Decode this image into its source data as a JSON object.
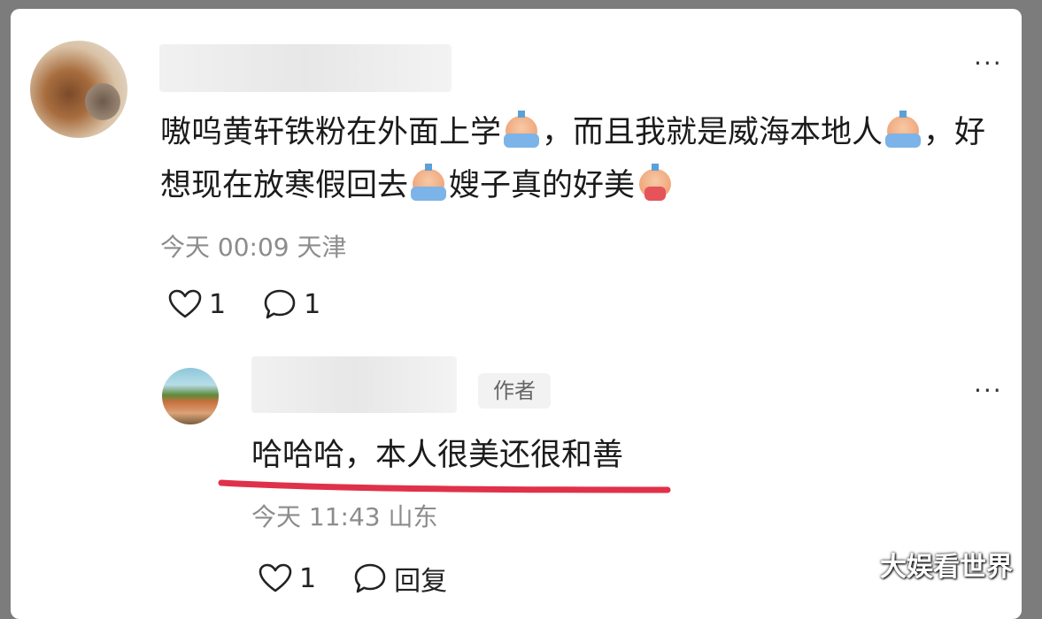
{
  "comment": {
    "text_parts": [
      "嗷呜黄轩铁粉在外面上学",
      "，而且我就是威海本地人",
      "，好想现在放寒假回去",
      "嫂子真的好美"
    ],
    "emoji_names": [
      "crying-emoji",
      "crying-emoji",
      "crying-emoji",
      "screaming-emoji"
    ],
    "meta": "今天 00:09 天津",
    "like_count": "1",
    "reply_count": "1"
  },
  "reply": {
    "author_badge": "作者",
    "text": "哈哈哈，本人很美还很和善",
    "meta": "今天 11:43 山东",
    "like_count": "1",
    "reply_label": "回复"
  },
  "watermark": "大娱看世界",
  "colors": {
    "underline": "#e0314a",
    "text": "#1b1b1b",
    "meta": "#8c8c8c",
    "badge_bg": "#f2f2f2"
  }
}
